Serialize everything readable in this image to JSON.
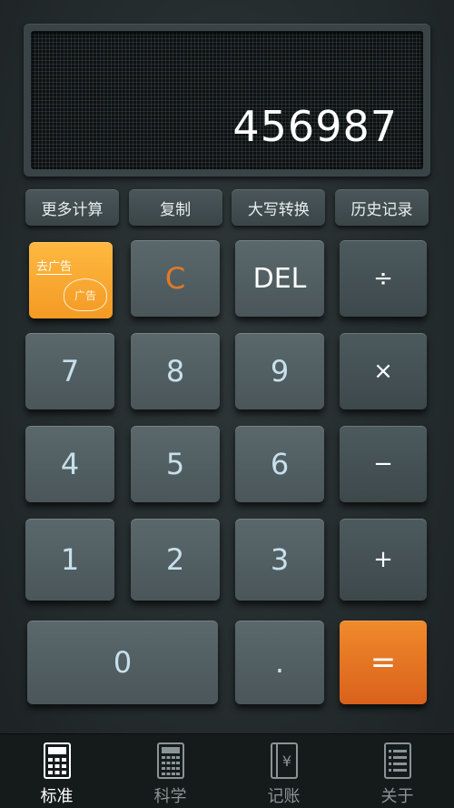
{
  "display": {
    "value": "456987"
  },
  "functions": [
    {
      "label": "更多计算"
    },
    {
      "label": "复制"
    },
    {
      "label": "大写转换"
    },
    {
      "label": "历史记录"
    }
  ],
  "keys": {
    "ad": {
      "label": "去广告",
      "stamp": "广告"
    },
    "clear": "C",
    "del": "DEL",
    "divide": "÷",
    "seven": "7",
    "eight": "8",
    "nine": "9",
    "multiply": "×",
    "four": "4",
    "five": "5",
    "six": "6",
    "minus": "−",
    "one": "1",
    "two": "2",
    "three": "3",
    "plus": "+",
    "zero": "0",
    "dot": ".",
    "equals": "="
  },
  "tabs": [
    {
      "label": "标准",
      "icon": "calculator-icon",
      "active": true
    },
    {
      "label": "科学",
      "icon": "scientific-calculator-icon",
      "active": false
    },
    {
      "label": "记账",
      "icon": "yen-ledger-icon",
      "active": false
    },
    {
      "label": "关于",
      "icon": "info-list-icon",
      "active": false
    }
  ],
  "colors": {
    "accent": "#e07a2a",
    "equals": "#e8721f",
    "ad": "#f9a82f"
  }
}
